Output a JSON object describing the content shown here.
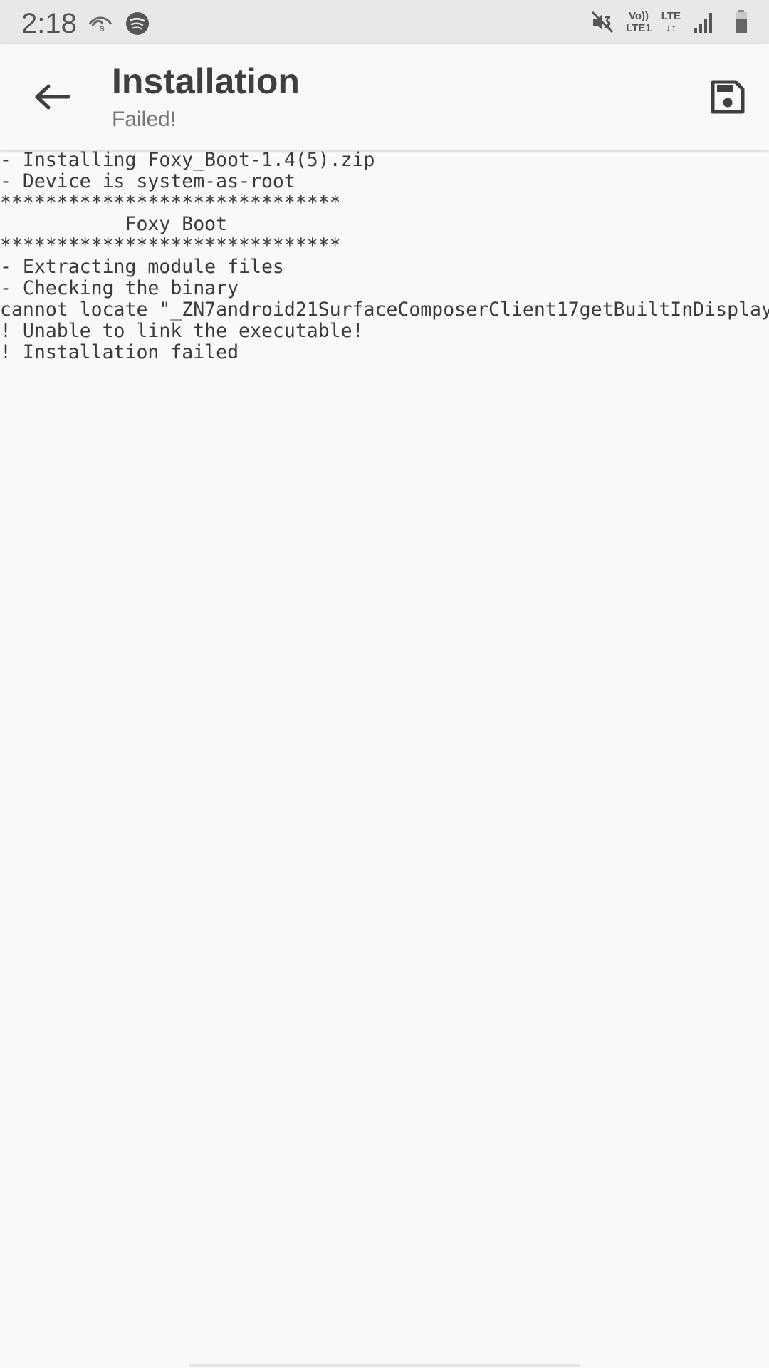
{
  "status_bar": {
    "time": "2:18",
    "left_icons": [
      "eye-comfort-icon",
      "spotify-icon"
    ],
    "right_icons": [
      "vibrate-mute-icon",
      "volte-icon",
      "lte-data-icon",
      "signal-icon",
      "battery-icon"
    ],
    "volte_top": "Vo))",
    "volte_bottom": "LTE1",
    "lte_top": "LTE",
    "lte_bottom": "↓↑"
  },
  "app_bar": {
    "back_icon": "arrow-back-icon",
    "title": "Installation",
    "subtitle": "Failed!",
    "save_icon": "save-icon"
  },
  "log": {
    "lines": [
      "- Installing Foxy_Boot-1.4(5).zip",
      "- Device is system-as-root",
      "******************************",
      "           Foxy Boot",
      "******************************",
      "- Extracting module files",
      "- Checking the binary",
      "cannot locate \"_ZN7android21SurfaceComposerClient17getBuiltInDisplay",
      "! Unable to link the executable!",
      "! Installation failed"
    ]
  },
  "colors": {
    "status_bar_bg": "#e8e8e8",
    "background": "#f9f9f9",
    "title": "#3f3f3f",
    "subtitle": "#777777",
    "log_text": "#3a3a3a"
  }
}
